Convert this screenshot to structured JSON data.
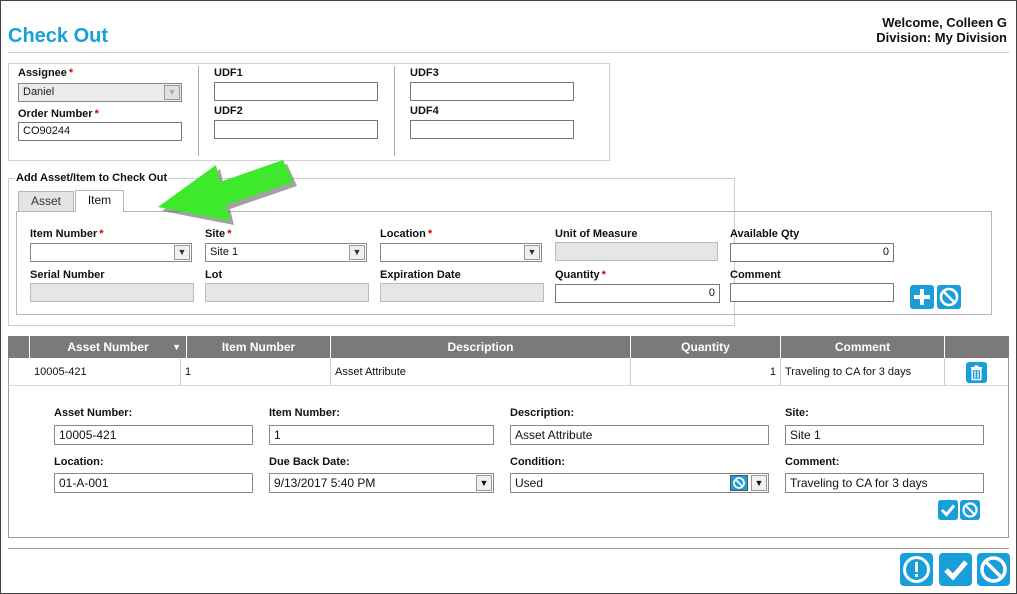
{
  "header": {
    "page_title": "Check Out",
    "welcome": "Welcome, Colleen G",
    "division": "Division: My Division"
  },
  "top_form": {
    "assignee_label": "Assignee",
    "assignee_value": "Daniel",
    "order_number_label": "Order Number",
    "order_number_value": "CO90244",
    "udf1_label": "UDF1",
    "udf2_label": "UDF2",
    "udf3_label": "UDF3",
    "udf4_label": "UDF4"
  },
  "add_section": {
    "title": "Add Asset/Item to Check Out",
    "tabs": [
      "Asset",
      "Item"
    ],
    "active_tab": "Item",
    "item_number_label": "Item Number",
    "site_label": "Site",
    "site_value": "Site 1",
    "location_label": "Location",
    "unit_of_measure_label": "Unit of Measure",
    "available_qty_label": "Available Qty",
    "available_qty_value": "0",
    "serial_number_label": "Serial Number",
    "lot_label": "Lot",
    "expiration_date_label": "Expiration Date",
    "quantity_label": "Quantity",
    "quantity_value": "0",
    "comment_label": "Comment"
  },
  "grid": {
    "columns": [
      "Asset Number",
      "Item Number",
      "Description",
      "Quantity",
      "Comment"
    ],
    "rows": [
      {
        "asset_number": "10005-421",
        "item_number": "1",
        "description": "Asset Attribute",
        "quantity": "1",
        "comment": "Traveling to CA for 3 days"
      }
    ]
  },
  "detail": {
    "asset_number_label": "Asset Number:",
    "asset_number_value": "10005-421",
    "item_number_label": "Item Number:",
    "item_number_value": "1",
    "description_label": "Description:",
    "description_value": "Asset Attribute",
    "site_label": "Site:",
    "site_value": "Site 1",
    "location_label": "Location:",
    "location_value": "01-A-001",
    "due_back_label": "Due Back Date:",
    "due_back_value": "9/13/2017 5:40 PM",
    "condition_label": "Condition:",
    "condition_value": "Used",
    "comment_label": "Comment:",
    "comment_value": "Traveling to CA for 3 days"
  },
  "icons": {
    "add": "plus-icon",
    "cancel": "cancel-icon",
    "delete": "trash-icon",
    "confirm": "check-icon",
    "alert": "exclamation-icon",
    "annotation": "green-arrow"
  },
  "colors": {
    "accent": "#1a9ed9",
    "title": "#1aa0d8",
    "grid_header": "#7a7a7a",
    "required": "#dd0000",
    "arrow": "#3ee82a"
  }
}
